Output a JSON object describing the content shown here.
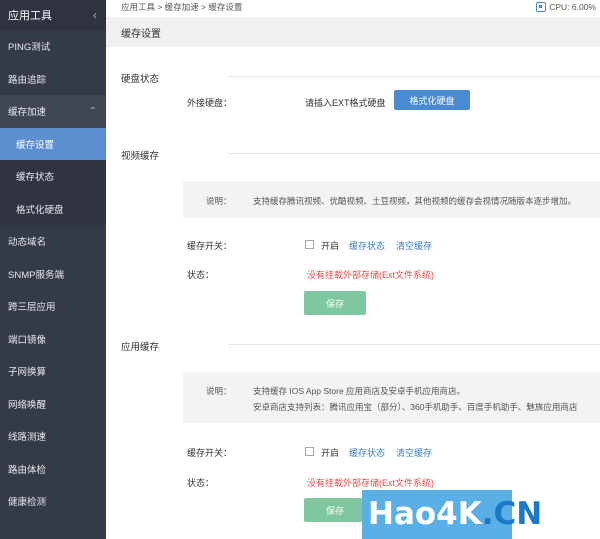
{
  "sidebar": {
    "title": "应用工具",
    "items_top": [
      "PING测试",
      "路由追踪"
    ],
    "group": {
      "label": "缓存加速",
      "children": [
        "缓存设置",
        "缓存状态",
        "格式化硬盘"
      ],
      "active": "缓存设置"
    },
    "items_bottom": [
      "动态域名",
      "SNMP服务端",
      "跨三层应用",
      "端口镜像",
      "子网换算",
      "网络唤醒",
      "线路测速",
      "路由体检",
      "健康检测"
    ]
  },
  "topbar": {
    "breadcrumb": "应用工具 > 缓存加速 > 缓存设置",
    "cpu": "CPU: 6.00%"
  },
  "panel": {
    "title": "缓存设置"
  },
  "disk": {
    "section": "硬盘状态",
    "label": "外接硬盘：",
    "value": "请插入EXT格式硬盘",
    "button": "格式化硬盘"
  },
  "video": {
    "section": "视频缓存",
    "note_label": "说明：",
    "note": "支持缓存腾讯视频、优酷视频、土豆视频，其他视频的缓存会视情况随版本逐步增加。",
    "switch_label": "缓存开关：",
    "enable": "开启",
    "status_link": "缓存状态",
    "clear_link": "清空缓存",
    "status_label": "状态：",
    "status": "没有挂载外部存储(Ext文件系统)",
    "save": "保存"
  },
  "app": {
    "section": "应用缓存",
    "note_label": "说明：",
    "note1": "支持缓存 IOS App Store 应用商店及安卓手机应用商店。",
    "note2": "安卓商店支持列表：腾讯应用宝（部分）、360手机助手、百度手机助手、魅族应用商店",
    "switch_label": "缓存开关：",
    "enable": "开启",
    "status_link": "缓存状态",
    "clear_link": "清空缓存",
    "status_label": "状态：",
    "status": "没有挂载外部存储(Ext文件系统)",
    "save": "保存"
  },
  "watermark": {
    "main": "Hao4K",
    "suffix": ".CN"
  }
}
